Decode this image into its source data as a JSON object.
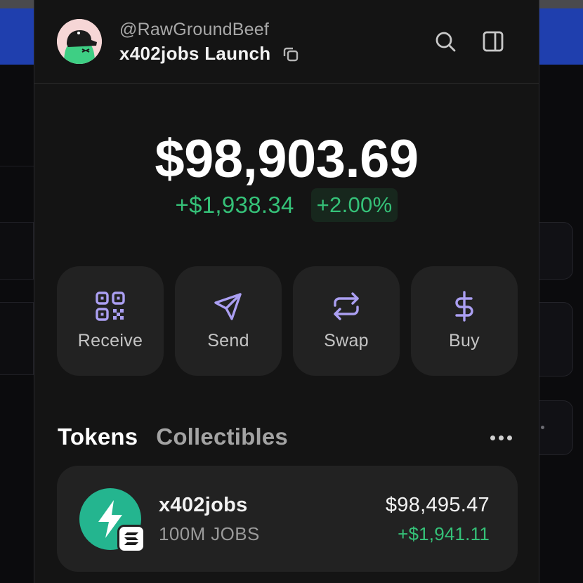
{
  "account": {
    "handle": "@RawGroundBeef",
    "name": "x402jobs Launch",
    "avatar_icon": "avatar-character-icon",
    "copy_icon": "copy-icon"
  },
  "header_actions": {
    "search_icon": "search-icon",
    "sidebar_icon": "sidebar-toggle-icon"
  },
  "portfolio": {
    "balance": "$98,903.69",
    "change_amount": "+$1,938.34",
    "change_percent": "+2.00%"
  },
  "actions": [
    {
      "label": "Receive",
      "icon": "qr-code-icon"
    },
    {
      "label": "Send",
      "icon": "send-icon"
    },
    {
      "label": "Swap",
      "icon": "swap-icon"
    },
    {
      "label": "Buy",
      "icon": "dollar-icon"
    }
  ],
  "tabs": [
    {
      "label": "Tokens",
      "active": true
    },
    {
      "label": "Collectibles",
      "active": false
    }
  ],
  "tokens": [
    {
      "name": "x402jobs",
      "amount": "100M JOBS",
      "value": "$98,495.47",
      "change": "+$1,941.11",
      "icon": "lightning-bolt-icon",
      "chain_icon": "solana-icon"
    }
  ],
  "colors": {
    "accent_purple": "#ab9ff2",
    "positive_green": "#35c178",
    "popup_background": "#141414",
    "button_background": "#222222",
    "token_logo_green": "#24b58f",
    "background_header_blue": "#1f3fae"
  }
}
